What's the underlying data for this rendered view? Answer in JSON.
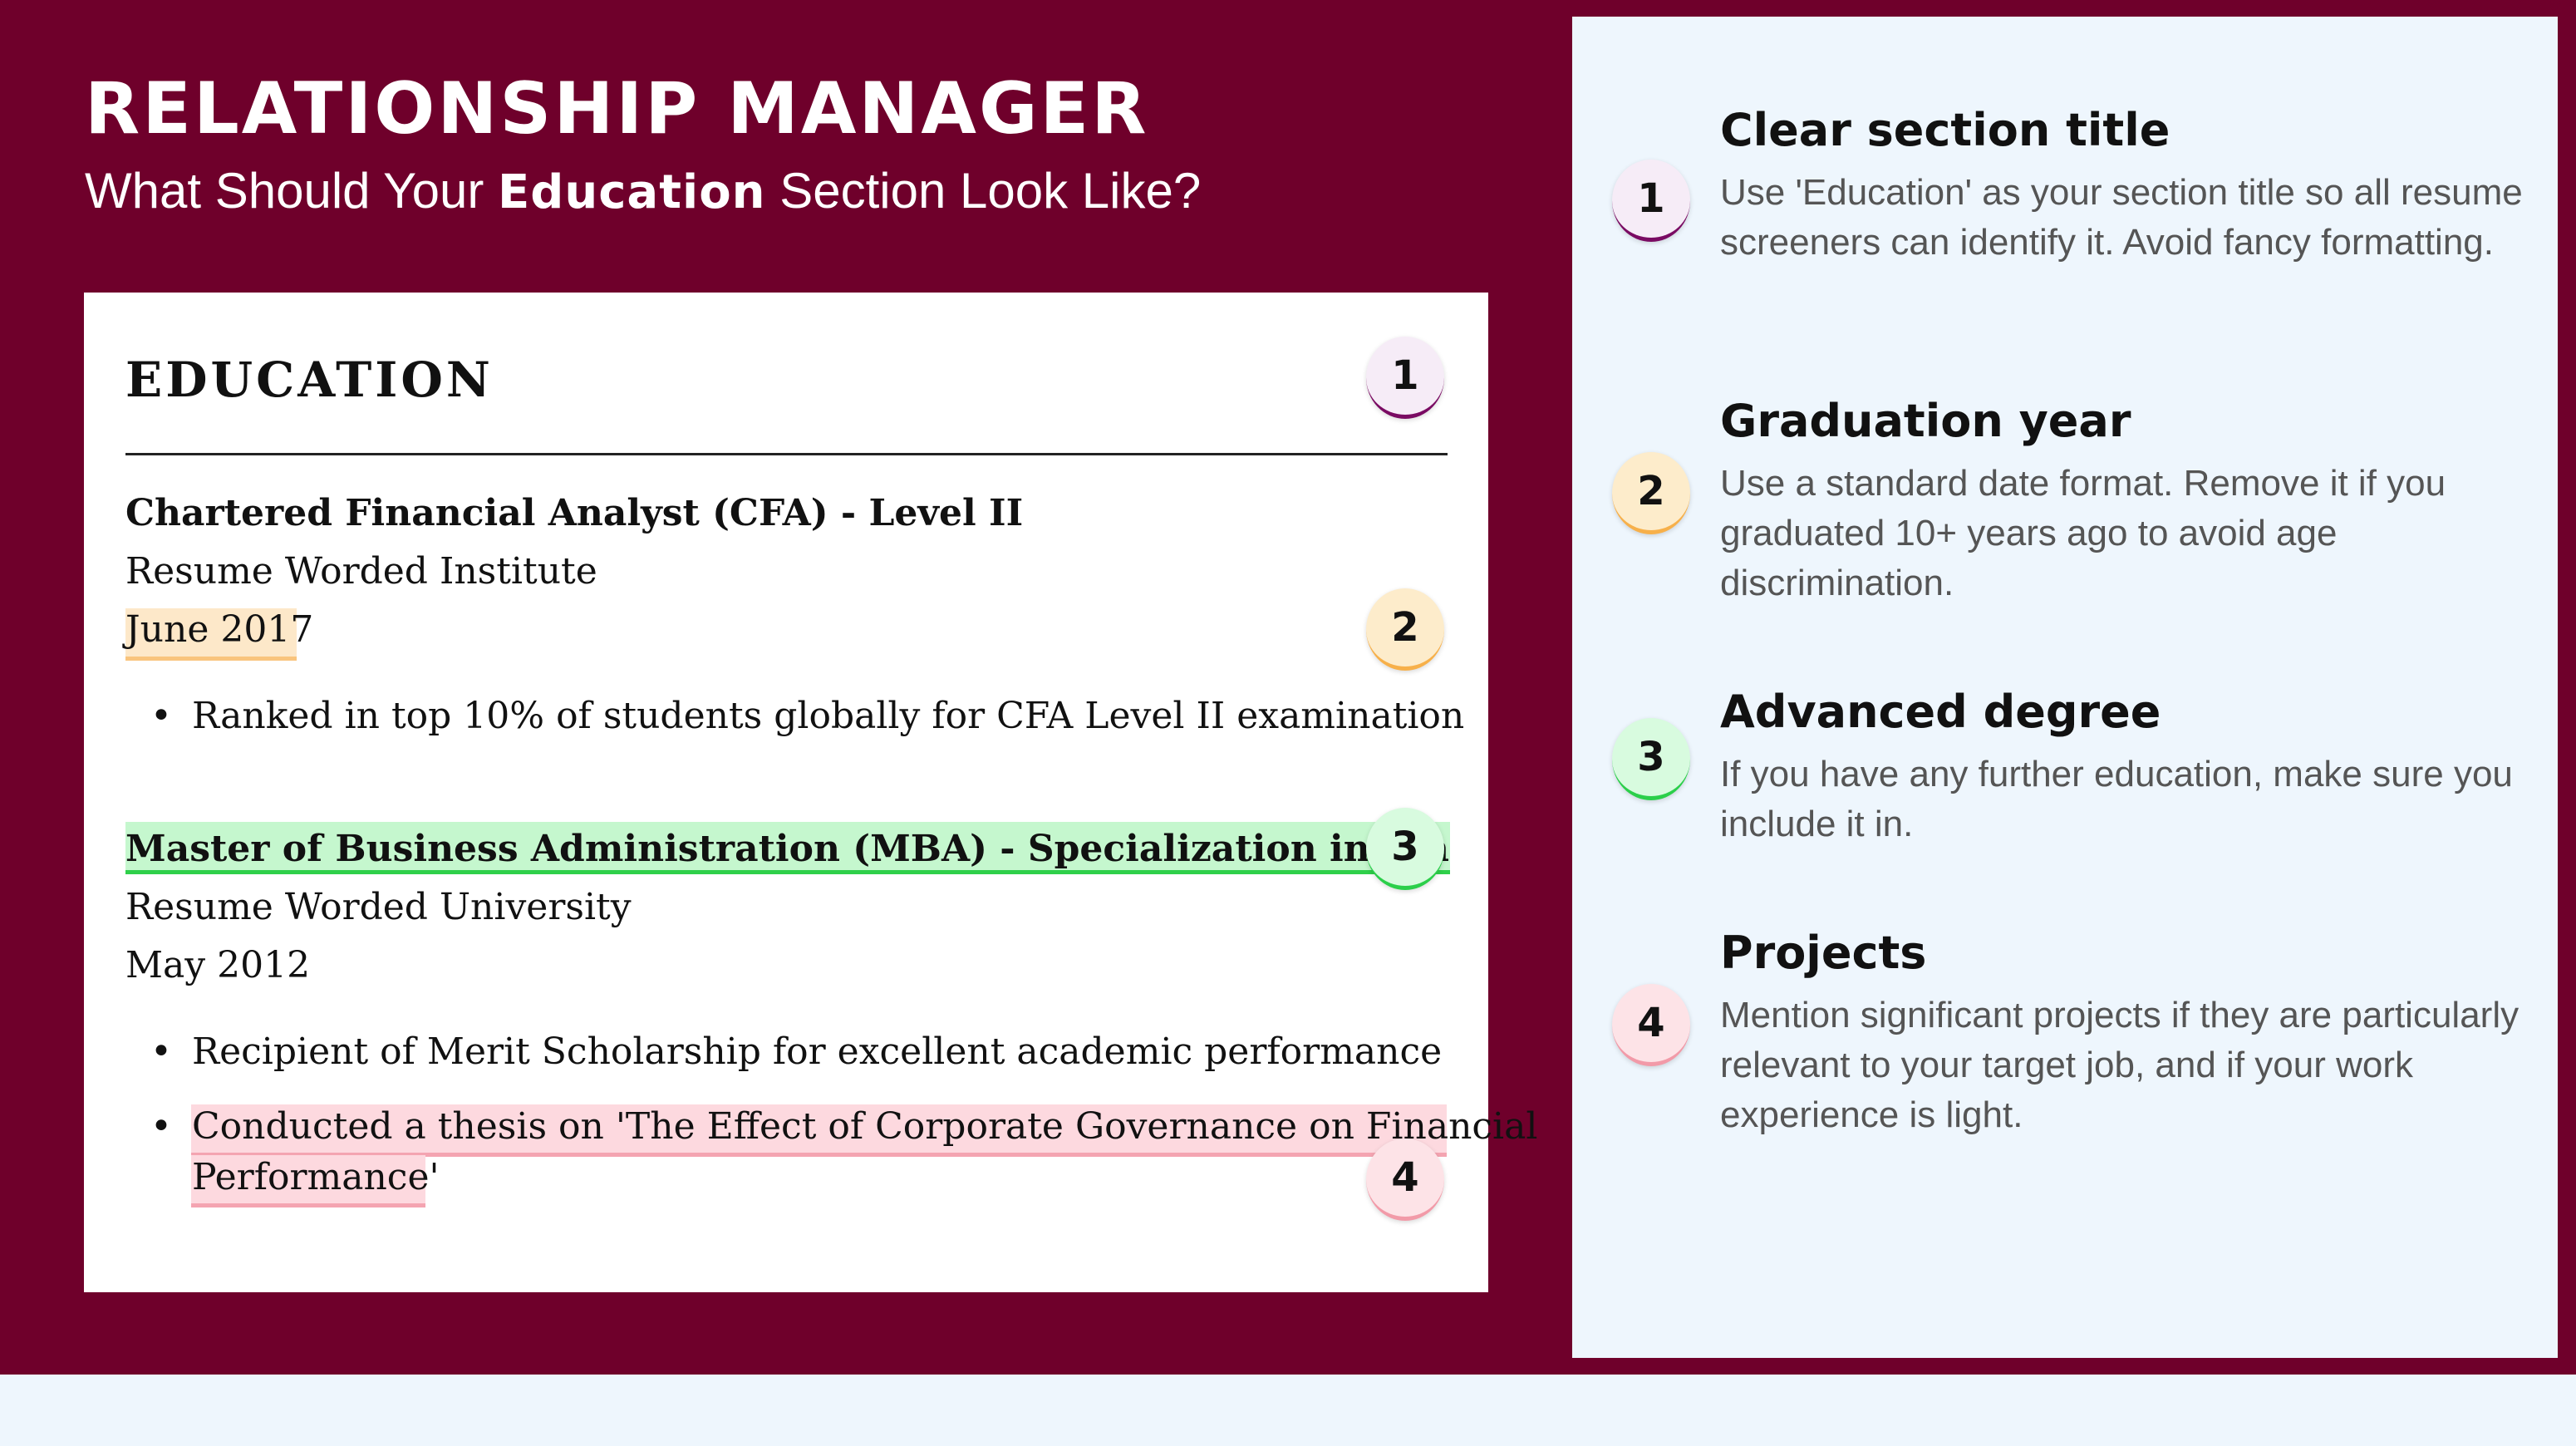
{
  "header": {
    "title": "RELATIONSHIP MANAGER",
    "subtitle_before": "What Should Your ",
    "subtitle_bold": "Education",
    "subtitle_after": " Section Look Like?"
  },
  "resume": {
    "section_heading": "EDUCATION",
    "entries": [
      {
        "degree": "Chartered Financial Analyst (CFA) - Level II",
        "institution": "Resume Worded Institute",
        "date": "June 2017",
        "bullets": [
          "Ranked in top 10% of students globally for CFA Level II examination"
        ]
      },
      {
        "degree": "Master of Business Administration (MBA) - Specialization in Finan",
        "institution": "Resume Worded University",
        "date": "May 2012",
        "bullets": [
          "Recipient of Merit Scholarship for excellent academic performance",
          "Conducted a thesis on 'The Effect of Corporate Governance on Financial",
          "Performance'"
        ]
      }
    ]
  },
  "badges": [
    "1",
    "2",
    "3",
    "4"
  ],
  "tips": [
    {
      "number": "1",
      "title": "Clear section title",
      "body": "Use 'Education' as your section title so all resume screeners can identify it. Avoid fancy formatting."
    },
    {
      "number": "2",
      "title": "Graduation year",
      "body": "Use a standard date format. Remove it if you graduated 10+ years ago to avoid age discrimination."
    },
    {
      "number": "3",
      "title": "Advanced degree",
      "body": "If you have any further education, make sure you include it in."
    },
    {
      "number": "4",
      "title": "Projects",
      "body": "Mention significant projects if they are particularly relevant to your target job, and if your work experience is light."
    }
  ],
  "colors": {
    "maroon": "#6f002b",
    "panel": "#eef6fd",
    "badge_1": "#7a0b63",
    "badge_2": "#f7b04a",
    "badge_3": "#2bcf4a",
    "badge_4": "#f29aa8"
  }
}
